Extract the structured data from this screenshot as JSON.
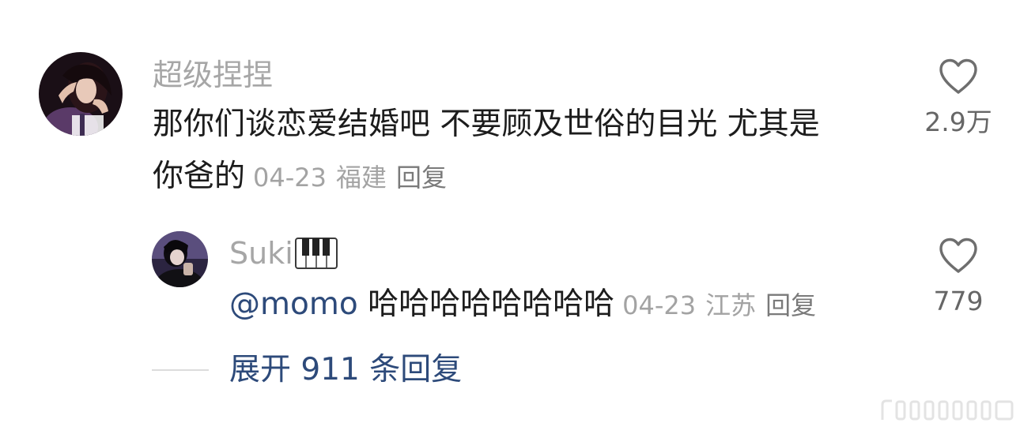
{
  "comment": {
    "username": "超级捏捏",
    "line1": "那你们谈恋爱结婚吧 不要顾及世俗的目光 尤其是",
    "line2": "你爸的",
    "date": "04-23",
    "location": "福建",
    "reply_label": "回复",
    "likes": "2.9万"
  },
  "reply": {
    "username": "Suki",
    "mention": "@momo",
    "text": "哈哈哈哈哈哈哈哈",
    "date": "04-23",
    "location": "江苏",
    "reply_label": "回复",
    "likes": "779"
  },
  "expand": {
    "label": "展开 911 条回复"
  },
  "icons": {
    "like": "heart-outline-icon",
    "username_badge": "piano-keys-icon"
  },
  "colors": {
    "username": "#a6a6a6",
    "meta": "#a3a3a3",
    "link": "#2d4a7a",
    "text": "#1c1c1c"
  }
}
